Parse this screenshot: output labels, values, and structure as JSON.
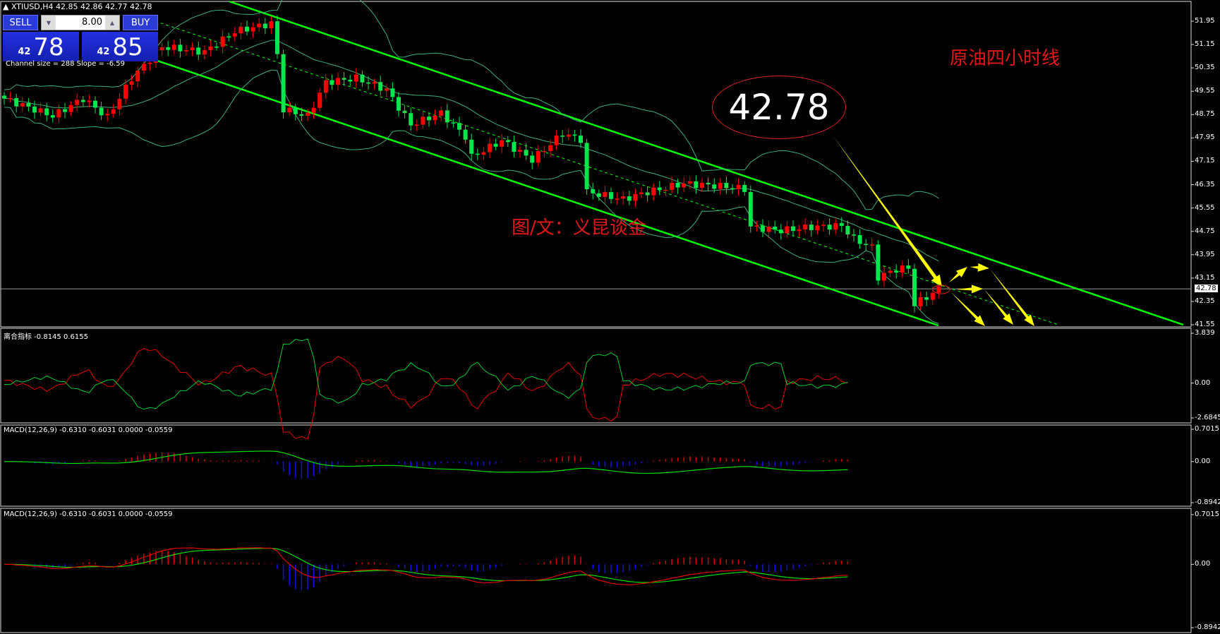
{
  "header": {
    "symbol": "XTIUSD,H4",
    "ohlc": "42.85 42.86 42.77 42.78"
  },
  "trade_panel": {
    "sell_label": "SELL",
    "buy_label": "BUY",
    "lot": "8.00",
    "sell_prefix": "42",
    "sell_big": "78",
    "buy_prefix": "42",
    "buy_big": "85",
    "channel_info": "Channel size = 288 Slope = -6.59"
  },
  "annotations": {
    "title": "原油四小时线",
    "credit": "图/文：义昆谈金",
    "callout": "42.78"
  },
  "colors": {
    "bull": "#ff0000",
    "bear": "#00e64d",
    "channel": "#00ff00",
    "band": "#3fae7a",
    "arrow": "#ffff00",
    "hist_pos": "#dd0000",
    "hist_neg": "#1010ee"
  },
  "chart_data": [
    {
      "type": "candlestick",
      "title": "XTIUSD,H4",
      "current_price": "42.78",
      "y_ticks": [
        "51.95",
        "51.15",
        "50.35",
        "49.55",
        "48.75",
        "47.95",
        "47.15",
        "46.35",
        "45.55",
        "44.75",
        "43.95",
        "43.15",
        "42.35",
        "41.55"
      ],
      "ylim": [
        41.55,
        51.95
      ],
      "close_anchors": [
        [
          0,
          49.3
        ],
        [
          8,
          48.7
        ],
        [
          13,
          49.3
        ],
        [
          17,
          48.66
        ],
        [
          21,
          50.0
        ],
        [
          26,
          51.07
        ],
        [
          33,
          50.9
        ],
        [
          38,
          51.6
        ],
        [
          44,
          51.87
        ],
        [
          45,
          50.8
        ],
        [
          46,
          48.93
        ],
        [
          50,
          48.7
        ],
        [
          53,
          49.86
        ],
        [
          58,
          50.0
        ],
        [
          63,
          49.6
        ],
        [
          67,
          48.4
        ],
        [
          72,
          48.8
        ],
        [
          76,
          48.0
        ],
        [
          77,
          47.3
        ],
        [
          82,
          47.86
        ],
        [
          87,
          47.2
        ],
        [
          92,
          48.1
        ],
        [
          95,
          47.9
        ],
        [
          96,
          46.1
        ],
        [
          102,
          45.85
        ],
        [
          106,
          46.1
        ],
        [
          112,
          46.39
        ],
        [
          118,
          46.3
        ],
        [
          122,
          46.2
        ],
        [
          123,
          44.9
        ],
        [
          128,
          44.78
        ],
        [
          133,
          44.9
        ],
        [
          138,
          44.95
        ],
        [
          140,
          44.5
        ],
        [
          143,
          44.2
        ],
        [
          144,
          43.18
        ],
        [
          147,
          43.45
        ],
        [
          149,
          43.5
        ],
        [
          150,
          42.25
        ],
        [
          152,
          42.5
        ],
        [
          154,
          42.78
        ]
      ]
    },
    {
      "type": "line",
      "title": "离合指标",
      "values_label": "-0.8145 0.6155",
      "y_ticks": [
        "3.839",
        "0.00",
        "-2.6845"
      ],
      "ylim": [
        -2.6845,
        3.839
      ]
    },
    {
      "type": "bar+line",
      "title": "MACD(12,26,9) -0.6310 -0.6031 0.0000 -0.0559",
      "y_ticks": [
        "0.7015",
        "0.00",
        "-0.8942"
      ],
      "ylim": [
        -0.8942,
        0.7015
      ]
    },
    {
      "type": "bar+line",
      "title": "MACD(12,26,9) -0.6310 -0.6031 0.0000 -0.0559",
      "y_ticks": [
        "0.7015",
        "0.00",
        "-0.8942"
      ],
      "ylim": [
        -0.8942,
        0.7015
      ]
    }
  ]
}
